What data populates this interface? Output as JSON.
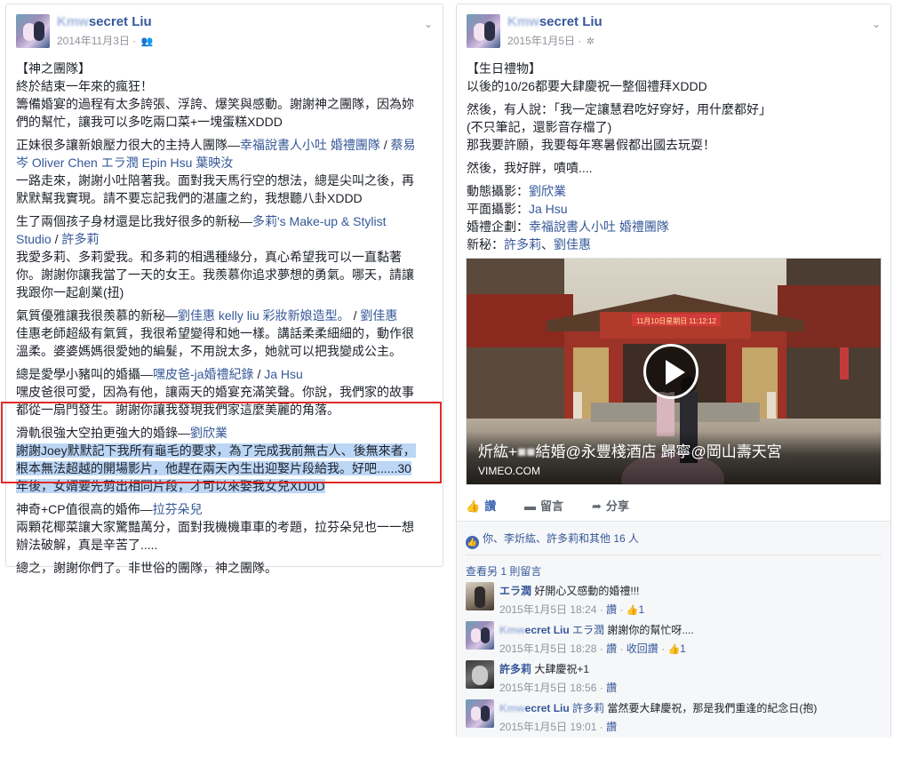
{
  "left_post": {
    "poster_name_blurred": "Kmw",
    "poster_name": "secret Liu",
    "date": "2014年11月3日",
    "audience_icon": "friends-icon",
    "paragraphs": [
      {
        "lines": [
          [
            {
              "t": "【神之團隊】"
            }
          ],
          [
            {
              "t": "終於結束一年來的瘋狂！"
            }
          ],
          [
            {
              "t": "籌備婚宴的過程有太多誇張、浮誇、爆笑與感動。謝謝神之團隊，因為妳"
            }
          ],
          [
            {
              "t": "們的幫忙，讓我可以多吃兩口菜+一塊蛋糕XDDD"
            }
          ]
        ]
      },
      {
        "lines": [
          [
            {
              "t": "正妹很多讓新娘壓力很大的主持人團隊—"
            },
            {
              "t": "幸福說書人小吐 婚禮團隊",
              "link": true
            },
            {
              "t": " / "
            },
            {
              "t": "蔡易",
              "link": true
            }
          ],
          [
            {
              "t": "岑 Oliver Chen エラ潤 Epin Hsu 葉映汝",
              "link": true
            }
          ],
          [
            {
              "t": "一路走來，謝謝小吐陪著我。面對我天馬行空的想法，總是尖叫之後，再"
            }
          ],
          [
            {
              "t": "默默幫我實現。請不要忘記我們的湛廬之約，我想聽八卦XDDD"
            }
          ]
        ]
      },
      {
        "lines": [
          [
            {
              "t": "生了兩個孩子身材還是比我好很多的新秘—"
            },
            {
              "t": "多莉's Make-up & Stylist",
              "link": true
            }
          ],
          [
            {
              "t": "Studio",
              "link": true
            },
            {
              "t": " / "
            },
            {
              "t": "許多莉",
              "link": true
            }
          ],
          [
            {
              "t": "我愛多莉、多莉愛我。和多莉的相遇種緣分，真心希望我可以一直黏著"
            }
          ],
          [
            {
              "t": "你。謝謝你讓我當了一天的女王。我羨慕你追求夢想的勇氣。哪天，請讓"
            }
          ],
          [
            {
              "t": "我跟你一起創業(扭)"
            }
          ]
        ]
      },
      {
        "lines": [
          [
            {
              "t": "氣質優雅讓我很羨慕的新秘—"
            },
            {
              "t": "劉佳惠 kelly liu 彩妝新娘造型。",
              "link": true
            },
            {
              "t": " / "
            },
            {
              "t": "劉佳惠",
              "link": true
            }
          ],
          [
            {
              "t": "佳惠老師超級有氣質，我很希望變得和她一樣。講話柔柔細細的，動作很"
            }
          ],
          [
            {
              "t": "溫柔。婆婆媽媽很愛她的編髮，不用說太多，她就可以把我變成公主。"
            }
          ]
        ]
      },
      {
        "lines": [
          [
            {
              "t": "總是愛學小豬叫的婚攝—"
            },
            {
              "t": "嘿皮爸-ja婚禮紀錄",
              "link": true
            },
            {
              "t": " / "
            },
            {
              "t": "Ja Hsu",
              "link": true
            }
          ],
          [
            {
              "t": "嘿皮爸很可愛，因為有他，讓兩天的婚宴充滿笑聲。你說，我們家的故事"
            }
          ],
          [
            {
              "t": "都從一扇門發生。謝謝你讓我發現我們家這麼美麗的角落。"
            }
          ]
        ]
      },
      {
        "lines": [
          [
            {
              "t": "滑軌很強大空拍更強大的婚錄—"
            },
            {
              "t": "劉欣業",
              "link": true
            }
          ],
          [
            {
              "t": "謝謝Joey默默記下我所有龜毛的要求，為了完成我前無古人、後無來者，",
              "sel": true
            }
          ],
          [
            {
              "t": "根本無法超越的開場影片，他趕在兩天內生出迎娶片段給我。好吧......30",
              "sel": true
            }
          ],
          [
            {
              "t": "年後，女婿要先剪出相同片段，才可以來娶我女兒XDDD",
              "sel": true
            }
          ]
        ]
      },
      {
        "lines": [
          [
            {
              "t": "神奇+CP值很高的婚佈—"
            },
            {
              "t": "拉芬朵兒",
              "link": true
            }
          ],
          [
            {
              "t": "兩顆花椰菜讓大家驚豔萬分，面對我機機車車的考題，拉芬朵兒也一一想"
            }
          ],
          [
            {
              "t": "辦法破解，真是辛苦了....."
            }
          ]
        ]
      },
      {
        "lines": [
          [
            {
              "t": "總之，謝謝你們了。非世俗的團隊，神之團隊。"
            }
          ]
        ]
      }
    ]
  },
  "right_post": {
    "poster_name_blurred": "Kmw",
    "poster_name": "secret Liu",
    "date": "2015年1月5日",
    "audience_icon": "globe-icon",
    "paragraphs": [
      {
        "lines": [
          [
            {
              "t": "【生日禮物】"
            }
          ],
          [
            {
              "t": "以後的10/26都要大肆慶祝一整個禮拜XDDD"
            }
          ]
        ]
      },
      {
        "lines": [
          [
            {
              "t": "然後，有人說：「我一定讓慧君吃好穿好，用什麼都好」"
            }
          ],
          [
            {
              "t": "(不只筆記，還影音存檔了)"
            }
          ],
          [
            {
              "t": "那我要許願，我要每年寒暑假都出國去玩耍！"
            }
          ]
        ]
      },
      {
        "lines": [
          [
            {
              "t": "然後，我好胖，嘖嘖...."
            }
          ]
        ]
      },
      {
        "lines": [
          [
            {
              "t": "動態攝影："
            },
            {
              "t": "劉欣業",
              "link": true
            }
          ],
          [
            {
              "t": "平面攝影："
            },
            {
              "t": "Ja Hsu",
              "link": true
            }
          ],
          [
            {
              "t": "婚禮企劃："
            },
            {
              "t": "幸福說書人小吐 婚禮團隊",
              "link": true
            }
          ],
          [
            {
              "t": "新秘："
            },
            {
              "t": "許多莉",
              "link": true
            },
            {
              "t": "、"
            },
            {
              "t": "劉佳惠",
              "link": true
            }
          ]
        ]
      }
    ],
    "video": {
      "title_pre": "炘紘+",
      "title_post": "結婚@永豐棧酒店 歸寧@岡山壽天宮",
      "source": "VIMEO.COM",
      "sign_text": "11月10日星期日 11:12:12"
    },
    "actions": [
      {
        "label": "讚",
        "icon": "thumbs-up-icon",
        "liked": true
      },
      {
        "label": "留言",
        "icon": "comment-icon",
        "liked": false
      },
      {
        "label": "分享",
        "icon": "share-icon",
        "liked": false
      }
    ],
    "likes_text": "你、李炘紘、許多莉和其他 16 人",
    "more_comments": "查看另 1 則留言",
    "comments": [
      {
        "avatar": "ela",
        "name_blurred": "",
        "name": "エラ潤",
        "text": "好開心又感動的婚禮!!!",
        "time": "2015年1月5日 18:24",
        "actions": [
          "讚"
        ],
        "likes": "1"
      },
      {
        "avatar": "liu",
        "name_blurred": "Kmw",
        "name": "ecret Liu",
        "mention": "エラ潤",
        "text": "謝謝你的幫忙呀....",
        "time": "2015年1月5日 18:28",
        "actions": [
          "讚",
          "收回讚"
        ],
        "likes": "1"
      },
      {
        "avatar": "xu",
        "name_blurred": "",
        "name": "許多莉",
        "text": "大肆慶祝+1",
        "time": "2015年1月5日 18:56",
        "actions": [
          "讚"
        ],
        "likes": ""
      },
      {
        "avatar": "liu",
        "name_blurred": "Kmw",
        "name": "ecret Liu",
        "mention": "許多莉",
        "text": "當然要大肆慶祝，那是我們重逢的紀念日(抱)",
        "time": "2015年1月5日 19:01",
        "actions": [
          "讚"
        ],
        "likes": ""
      }
    ]
  },
  "colors": {
    "link": "#365899",
    "meta": "#90949c",
    "highlight_border": "#e0292a",
    "selection": "#bcd6f5",
    "like_blue": "#4267b2"
  }
}
